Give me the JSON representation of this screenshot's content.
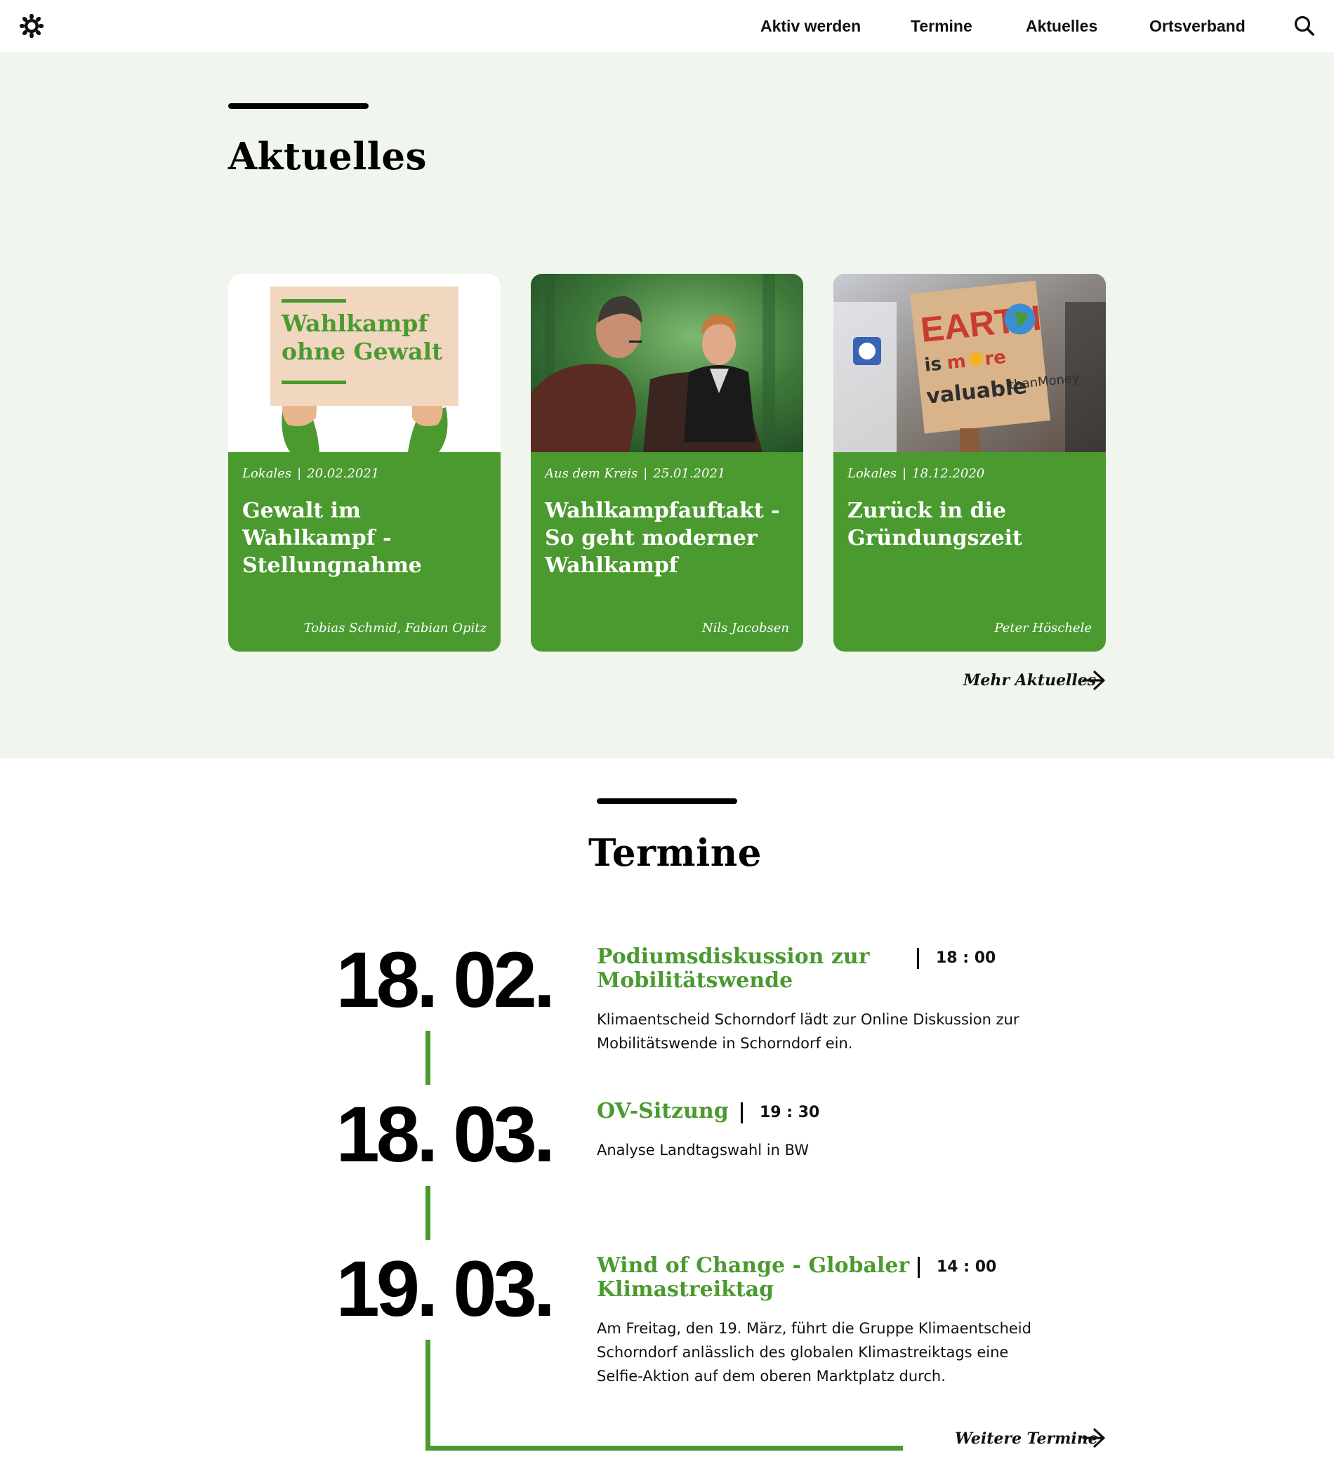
{
  "nav": {
    "items": [
      "Aktiv werden",
      "Termine",
      "Aktuelles",
      "Ortsverband"
    ]
  },
  "news": {
    "title": "Aktuelles",
    "cards": [
      {
        "category": "Lokales",
        "date": "20.02.2021",
        "title": "Gewalt im Wahlkampf - Stellungnahme",
        "author": "Tobias Schmid, Fabian Opitz",
        "image_sign_line1": "Wahlkampf",
        "image_sign_line2": "ohne Gewalt"
      },
      {
        "category": "Aus dem Kreis",
        "date": "25.01.2021",
        "title": "Wahlkampfauftakt - So geht moderner Wahlkampf",
        "author": "Nils Jacobsen"
      },
      {
        "category": "Lokales",
        "date": "18.12.2020",
        "title": "Zurück in die Gründungszeit",
        "author": "Peter Höschele"
      }
    ],
    "more_label": "Mehr Aktuelles"
  },
  "events": {
    "title": "Termine",
    "items": [
      {
        "date": "18. 02.",
        "title": "Podiumsdiskussion zur Mobilitätswende",
        "time": "18 : 00",
        "description": "Klimaentscheid Schorndorf lädt zur Online Diskussion zur Mobilitätswende in Schorndorf ein."
      },
      {
        "date": "18. 03.",
        "title": "OV-Sitzung",
        "time": "19 : 30",
        "description": "Analyse Landtagswahl in BW"
      },
      {
        "date": "19. 03.",
        "title": "Wind of Change - Globaler Klimastreiktag",
        "time": "14 : 00",
        "description": "Am Freitag, den 19. März, führt die Gruppe Klimaentscheid Schorndorf anlässlich des globalen Klimastreiktags eine Selfie-Aktion auf dem oberen Marktplatz durch."
      }
    ],
    "more_label": "Weitere Termine"
  },
  "colors": {
    "green": "#4a9a2f",
    "section_bg": "#f0f5ee",
    "text": "#111111"
  },
  "icons": [
    "sunflower-logo-icon",
    "search-icon",
    "arrow-right-icon"
  ]
}
